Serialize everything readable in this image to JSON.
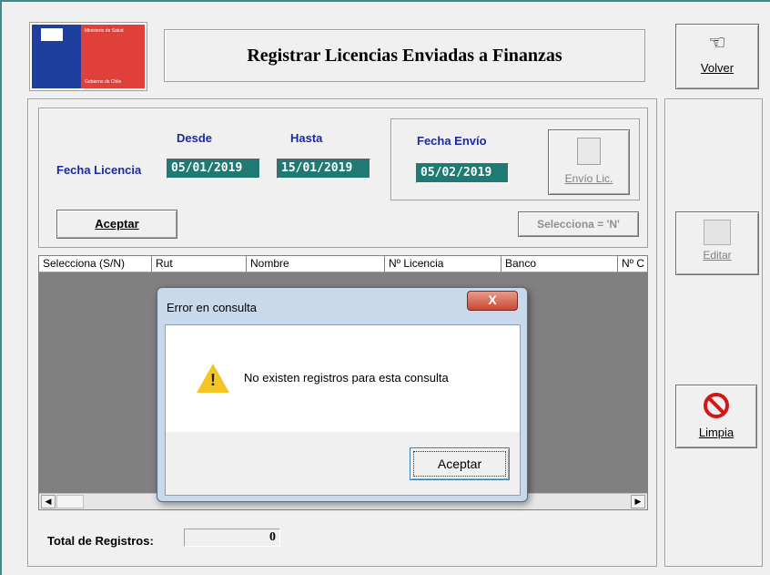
{
  "window": {
    "title": "Registrar Licencias Enviadas a Finanzas",
    "logo_text_1": "Ministerio de Salud",
    "logo_text_2": "Gobierno de Chile"
  },
  "sidebar": {
    "volver_label": "Volver",
    "editar_label": "Editar",
    "limpia_label": "Limpia"
  },
  "filters": {
    "fecha_licencia_label": "Fecha Licencia",
    "desde_label": "Desde",
    "hasta_label": "Hasta",
    "desde_value": "05/01/2019",
    "hasta_value": "15/01/2019",
    "fecha_envio_label": "Fecha Envío",
    "fecha_envio_value": "05/02/2019",
    "envio_button_label": "Envío Lic.",
    "aceptar_label": "Aceptar",
    "selecciona_label": "Selecciona = 'N'"
  },
  "grid": {
    "columns": [
      "Selecciona (S/N)",
      "Rut",
      "Nombre",
      "Nº Licencia",
      "Banco",
      "Nº C"
    ]
  },
  "footer": {
    "total_label": "Total de Registros:",
    "total_value": "0"
  },
  "dialog": {
    "title": "Error en consulta",
    "close_glyph": "X",
    "message": "No existen registros para esta consulta",
    "ok_label": "Aceptar"
  },
  "colors": {
    "field_bg": "#1f7a73",
    "label_blue": "#1b2a9e",
    "border_teal": "#3a8f8a"
  }
}
